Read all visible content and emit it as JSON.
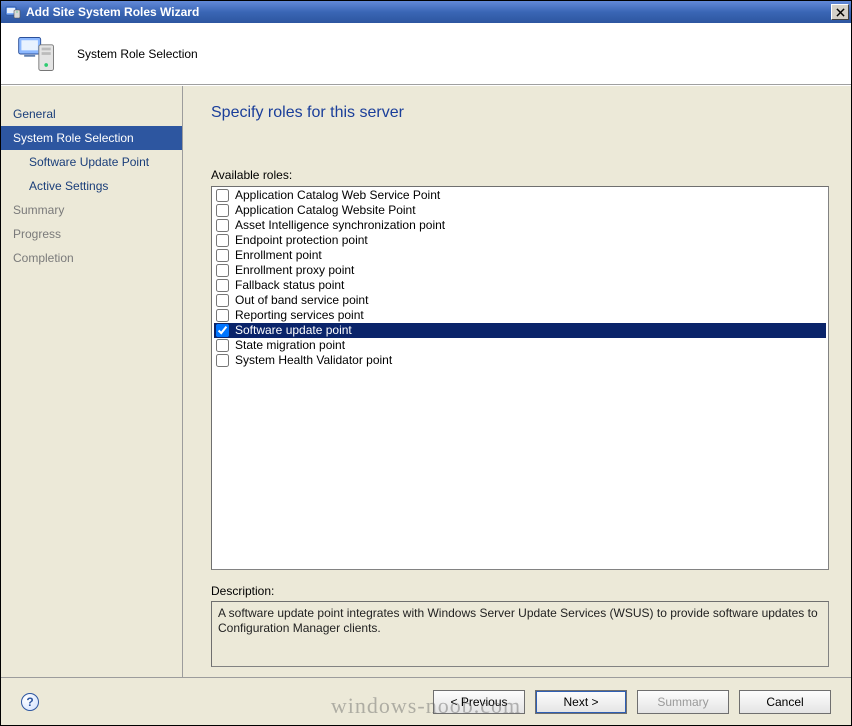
{
  "window": {
    "title": "Add Site System Roles Wizard"
  },
  "header": {
    "subtitle": "System Role Selection"
  },
  "sidebar": {
    "items": [
      {
        "label": "General",
        "sub": false,
        "active": false,
        "muted": false
      },
      {
        "label": "System Role Selection",
        "sub": false,
        "active": true,
        "muted": false
      },
      {
        "label": "Software Update Point",
        "sub": true,
        "active": false,
        "muted": false
      },
      {
        "label": "Active Settings",
        "sub": true,
        "active": false,
        "muted": false
      },
      {
        "label": "Summary",
        "sub": false,
        "active": false,
        "muted": true
      },
      {
        "label": "Progress",
        "sub": false,
        "active": false,
        "muted": true
      },
      {
        "label": "Completion",
        "sub": false,
        "active": false,
        "muted": true
      }
    ]
  },
  "content": {
    "heading": "Specify roles for this server",
    "roles_label": "Available roles:",
    "roles": [
      {
        "label": "Application Catalog Web Service Point",
        "checked": false,
        "selected": false
      },
      {
        "label": "Application Catalog Website Point",
        "checked": false,
        "selected": false
      },
      {
        "label": "Asset Intelligence synchronization point",
        "checked": false,
        "selected": false
      },
      {
        "label": "Endpoint protection point",
        "checked": false,
        "selected": false
      },
      {
        "label": "Enrollment point",
        "checked": false,
        "selected": false
      },
      {
        "label": "Enrollment proxy point",
        "checked": false,
        "selected": false
      },
      {
        "label": "Fallback status point",
        "checked": false,
        "selected": false
      },
      {
        "label": "Out of band service point",
        "checked": false,
        "selected": false
      },
      {
        "label": "Reporting services point",
        "checked": false,
        "selected": false
      },
      {
        "label": "Software update point",
        "checked": true,
        "selected": true
      },
      {
        "label": "State migration point",
        "checked": false,
        "selected": false
      },
      {
        "label": "System Health Validator point",
        "checked": false,
        "selected": false
      }
    ],
    "description_label": "Description:",
    "description_text": "A software update point integrates with Windows Server Update Services (WSUS) to provide software updates to Configuration Manager clients."
  },
  "footer": {
    "previous": "< Previous",
    "next": "Next >",
    "summary": "Summary",
    "cancel": "Cancel",
    "summary_enabled": false
  },
  "watermark": "windows-noob.com"
}
